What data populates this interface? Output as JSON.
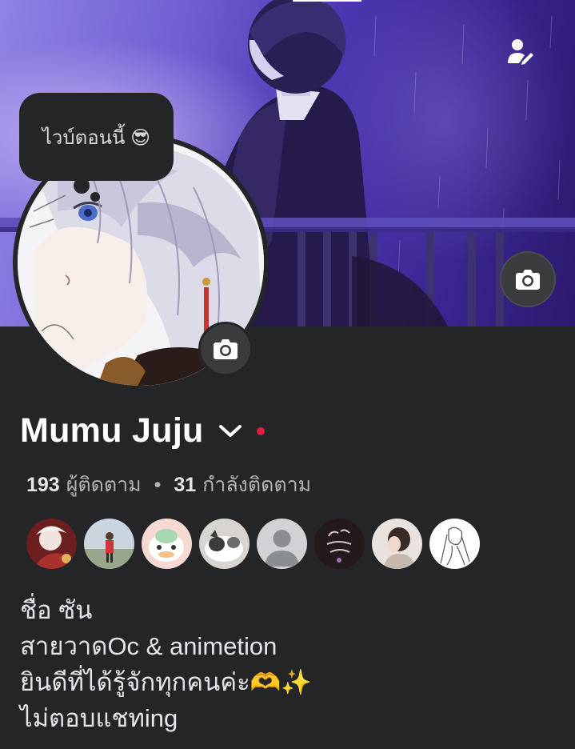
{
  "header": {
    "edit_icon": "person-edit-icon",
    "cover_camera_icon": "camera-icon"
  },
  "note": {
    "text": "ไวบ์ตอนนี้ 😎"
  },
  "profile": {
    "name": "Mumu Juju",
    "chevron_icon": "chevron-down-icon",
    "avatar_camera_icon": "camera-icon",
    "status_color": "#e41e3f"
  },
  "stats": {
    "followers_count": "193",
    "followers_label": "ผู้ติดตาม",
    "separator": "•",
    "following_count": "31",
    "following_label": "กำลังติดตาม"
  },
  "friends": [
    {
      "name": "friend-avatar-1"
    },
    {
      "name": "friend-avatar-2"
    },
    {
      "name": "friend-avatar-3"
    },
    {
      "name": "friend-avatar-4"
    },
    {
      "name": "friend-avatar-5"
    },
    {
      "name": "friend-avatar-6"
    },
    {
      "name": "friend-avatar-7"
    },
    {
      "name": "friend-avatar-8"
    }
  ],
  "bio": {
    "line1": "ชื่อ ซัน",
    "line2": "สายวาดOc & animetion",
    "line3": "ยินดีที่ได้รู้จักทุกคนค่ะ🫶✨",
    "line4": "ไม่ตอบแชทing"
  },
  "colors": {
    "background": "#242526",
    "text_primary": "#e4e6eb",
    "text_secondary": "#b0b3b8",
    "button_bg": "#3a3b3c"
  }
}
